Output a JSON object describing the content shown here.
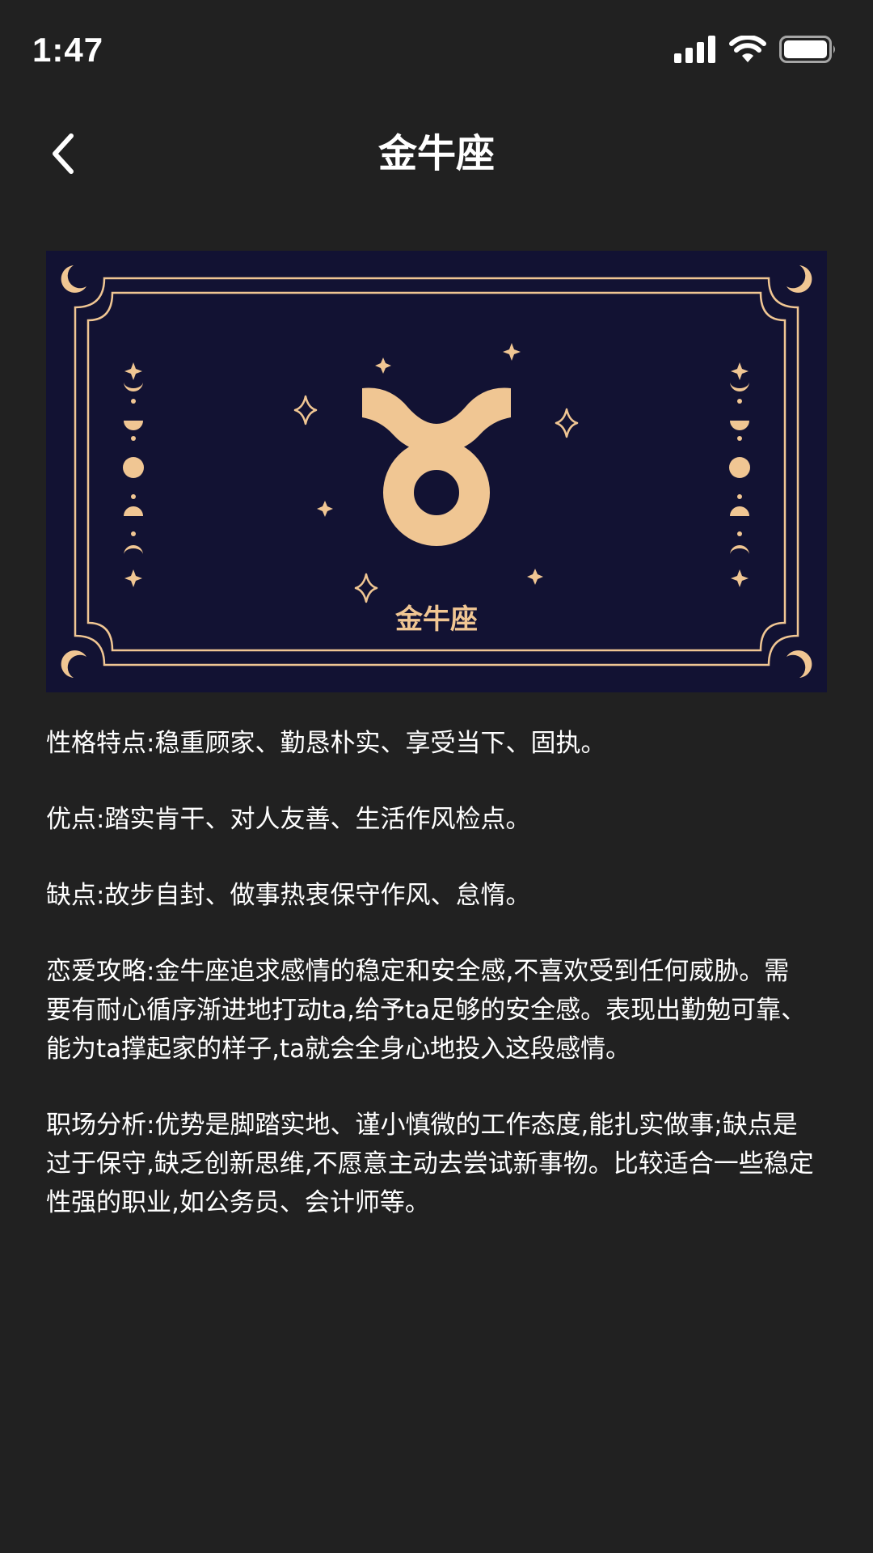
{
  "status_bar": {
    "time": "1:47"
  },
  "nav": {
    "title": "金牛座",
    "back_icon": "chevron-left-icon"
  },
  "banner": {
    "label": "金牛座",
    "symbol": "taurus",
    "colors": {
      "background": "#121233",
      "accent": "#f0c693"
    }
  },
  "content": {
    "paragraphs": [
      "性格特点:稳重顾家、勤恳朴实、享受当下、固执。",
      "优点:踏实肯干、对人友善、生活作风检点。",
      "缺点:故步自封、做事热衷保守作风、怠惰。",
      "恋爱攻略:金牛座追求感情的稳定和安全感,不喜欢受到任何威胁。需要有耐心循序渐进地打动ta,给予ta足够的安全感。表现出勤勉可靠、能为ta撑起家的样子,ta就会全身心地投入这段感情。",
      "职场分析:优势是脚踏实地、谨小慎微的工作态度,能扎实做事;缺点是过于保守,缺乏创新思维,不愿意主动去尝试新事物。比较适合一些稳定性强的职业,如公务员、会计师等。"
    ]
  },
  "colors": {
    "page_background": "#212121",
    "text": "#ffffff"
  }
}
